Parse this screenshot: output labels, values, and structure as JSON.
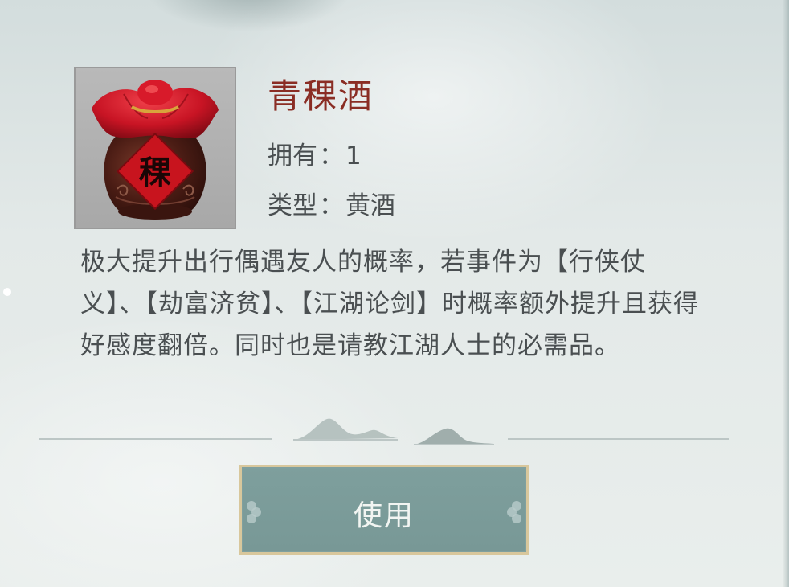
{
  "item": {
    "name": "青稞酒",
    "icon_label": "稞",
    "icon": "wine-jar-icon"
  },
  "info": {
    "own_label": "拥有",
    "own_value": "1",
    "type_label": "类型",
    "type_value": "黄酒",
    "separator": "："
  },
  "description": "极大提升出行偶遇友人的概率，若事件为【行侠仗义】、【劫富济贫】、【江湖论剑】时概率额外提升且获得好感度翻倍。同时也是请教江湖人士的必需品。",
  "actions": {
    "use_label": "使用"
  },
  "colors": {
    "name": "#8a2d24",
    "text": "#4a4f51",
    "button_bg": "#7e9f9d",
    "button_border": "#d8c79c"
  }
}
